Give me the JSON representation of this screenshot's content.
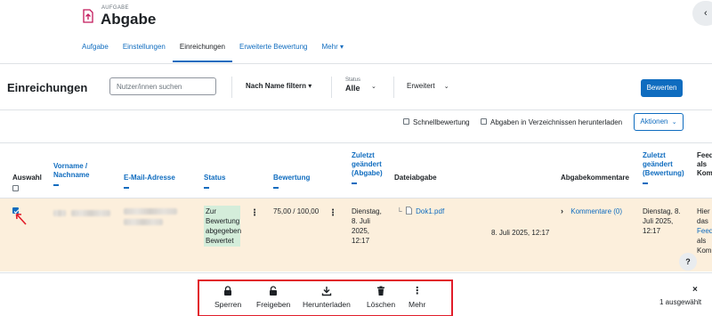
{
  "header": {
    "pretitle": "AUFGABE",
    "title": "Abgabe",
    "icon": "assignment-icon",
    "tabs": [
      {
        "label": "Aufgabe",
        "active": false
      },
      {
        "label": "Einstellungen",
        "active": false
      },
      {
        "label": "Einreichungen",
        "active": true
      },
      {
        "label": "Erweiterte Bewertung",
        "active": false
      },
      {
        "label": "Mehr ▾",
        "active": false
      }
    ]
  },
  "filterbar": {
    "title": "Einreichungen",
    "search_placeholder": "Nutzer/innen suchen",
    "name_filter": "Nach Name filtern ▾",
    "status_label": "Status",
    "status_value": "Alle",
    "advanced": "Erweitert",
    "grade_button": "Bewerten"
  },
  "options": {
    "quick_grading": "Schnellbewertung",
    "download_folders": "Abgaben in Verzeichnissen herunterladen",
    "actions_button": "Aktionen"
  },
  "table": {
    "headers": {
      "select": "Auswahl",
      "name_l1": "Vorname /",
      "name_l2": "Nachname",
      "email": "E-Mail-Adresse",
      "status": "Status",
      "grade": "Bewertung",
      "modified_l1": "Zuletzt",
      "modified_l2": "geändert",
      "modified_l3": "(Abgabe)",
      "file": "Dateiabgabe",
      "comments": "Abgabekommentare",
      "gmod_l1": "Zuletzt",
      "gmod_l2": "geändert",
      "gmod_l3": "(Bewertung)",
      "feedback_l1": "Feed",
      "feedback_l2": "als",
      "feedback_l3": "Kom"
    },
    "row": {
      "selected": true,
      "status_lines": [
        "Zur",
        "Bewertung",
        "abgegeben",
        "Bewertet"
      ],
      "grade": "75,00 / 100,00",
      "modified_lines": [
        "Dienstag,",
        "8. Juli",
        "2025,",
        "12:17"
      ],
      "file_name": "Dok1.pdf",
      "file_date": "8. Juli 2025, 12:17",
      "comments": "Kommentare (0)",
      "gmod_lines": [
        "Dienstag, 8.",
        "Juli 2025,",
        "12:17"
      ],
      "feedback_lines": [
        "Hier",
        "das",
        "Feed",
        "als",
        "Kom"
      ]
    },
    "help": "?"
  },
  "footer": {
    "actions": [
      {
        "label": "Sperren",
        "icon": "lock-icon"
      },
      {
        "label": "Freigeben",
        "icon": "unlock-icon"
      },
      {
        "label": "Herunterladen",
        "icon": "download-icon"
      },
      {
        "label": "Löschen",
        "icon": "trash-icon"
      },
      {
        "label": "Mehr",
        "icon": "more-vertical-icon"
      }
    ],
    "close": "×",
    "selected_count": "1 ausgewählt"
  },
  "colors": {
    "primary": "#0f6cbf",
    "row_highlight": "#fcefdc",
    "status_badge": "#d4edda",
    "highlight_box": "#e11d2a",
    "assignment_icon": "#c2185b"
  }
}
